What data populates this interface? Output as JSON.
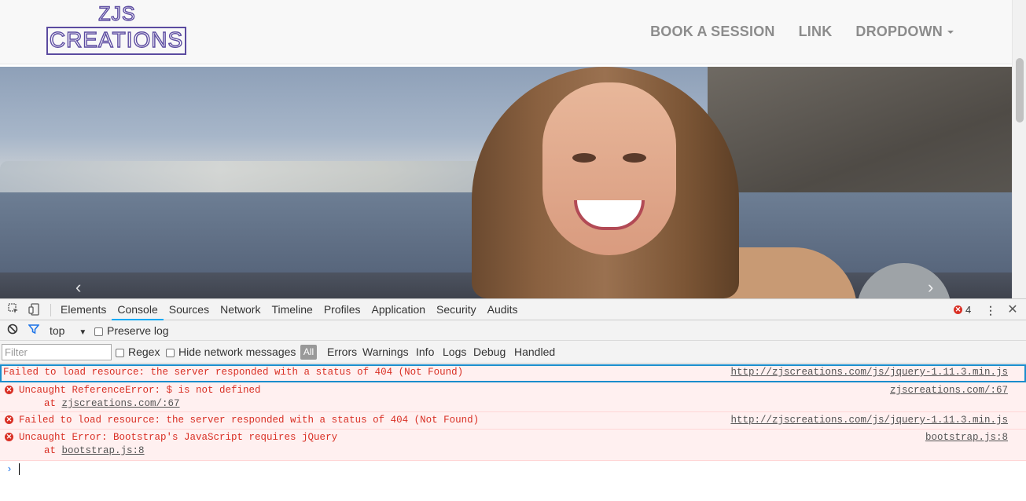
{
  "site": {
    "logo_line1": "ZJS",
    "logo_line2": "CREATIONS",
    "nav": [
      "BOOK A SESSION",
      "LINK",
      "DROPDOWN"
    ],
    "carousel_prev": "‹",
    "carousel_next": "›"
  },
  "devtools": {
    "tabs": [
      "Elements",
      "Console",
      "Sources",
      "Network",
      "Timeline",
      "Profiles",
      "Application",
      "Security",
      "Audits"
    ],
    "active_tab": "Console",
    "error_count": "4",
    "context": "top",
    "preserve_log": "Preserve log",
    "filter_placeholder": "Filter",
    "regex": "Regex",
    "hide_network": "Hide network messages",
    "level_all": "All",
    "levels": [
      "Errors",
      "Warnings",
      "Info",
      "Logs",
      "Debug",
      "Handled"
    ],
    "messages": [
      {
        "text": "Failed to load resource: the server responded with a status of 404 (Not Found)",
        "source": "http://zjscreations.com/js/jquery-1.11.3.min.js"
      },
      {
        "text": "Uncaught ReferenceError: $ is not defined",
        "sub_prefix": "at ",
        "sub_link": "zjscreations.com/:67",
        "source": "zjscreations.com/:67"
      },
      {
        "text": "Failed to load resource: the server responded with a status of 404 (Not Found)",
        "source": "http://zjscreations.com/js/jquery-1.11.3.min.js"
      },
      {
        "text": "Uncaught Error: Bootstrap's JavaScript requires jQuery",
        "sub_prefix": "at ",
        "sub_link": "bootstrap.js:8",
        "source": "bootstrap.js:8"
      }
    ],
    "prompt": "›"
  }
}
